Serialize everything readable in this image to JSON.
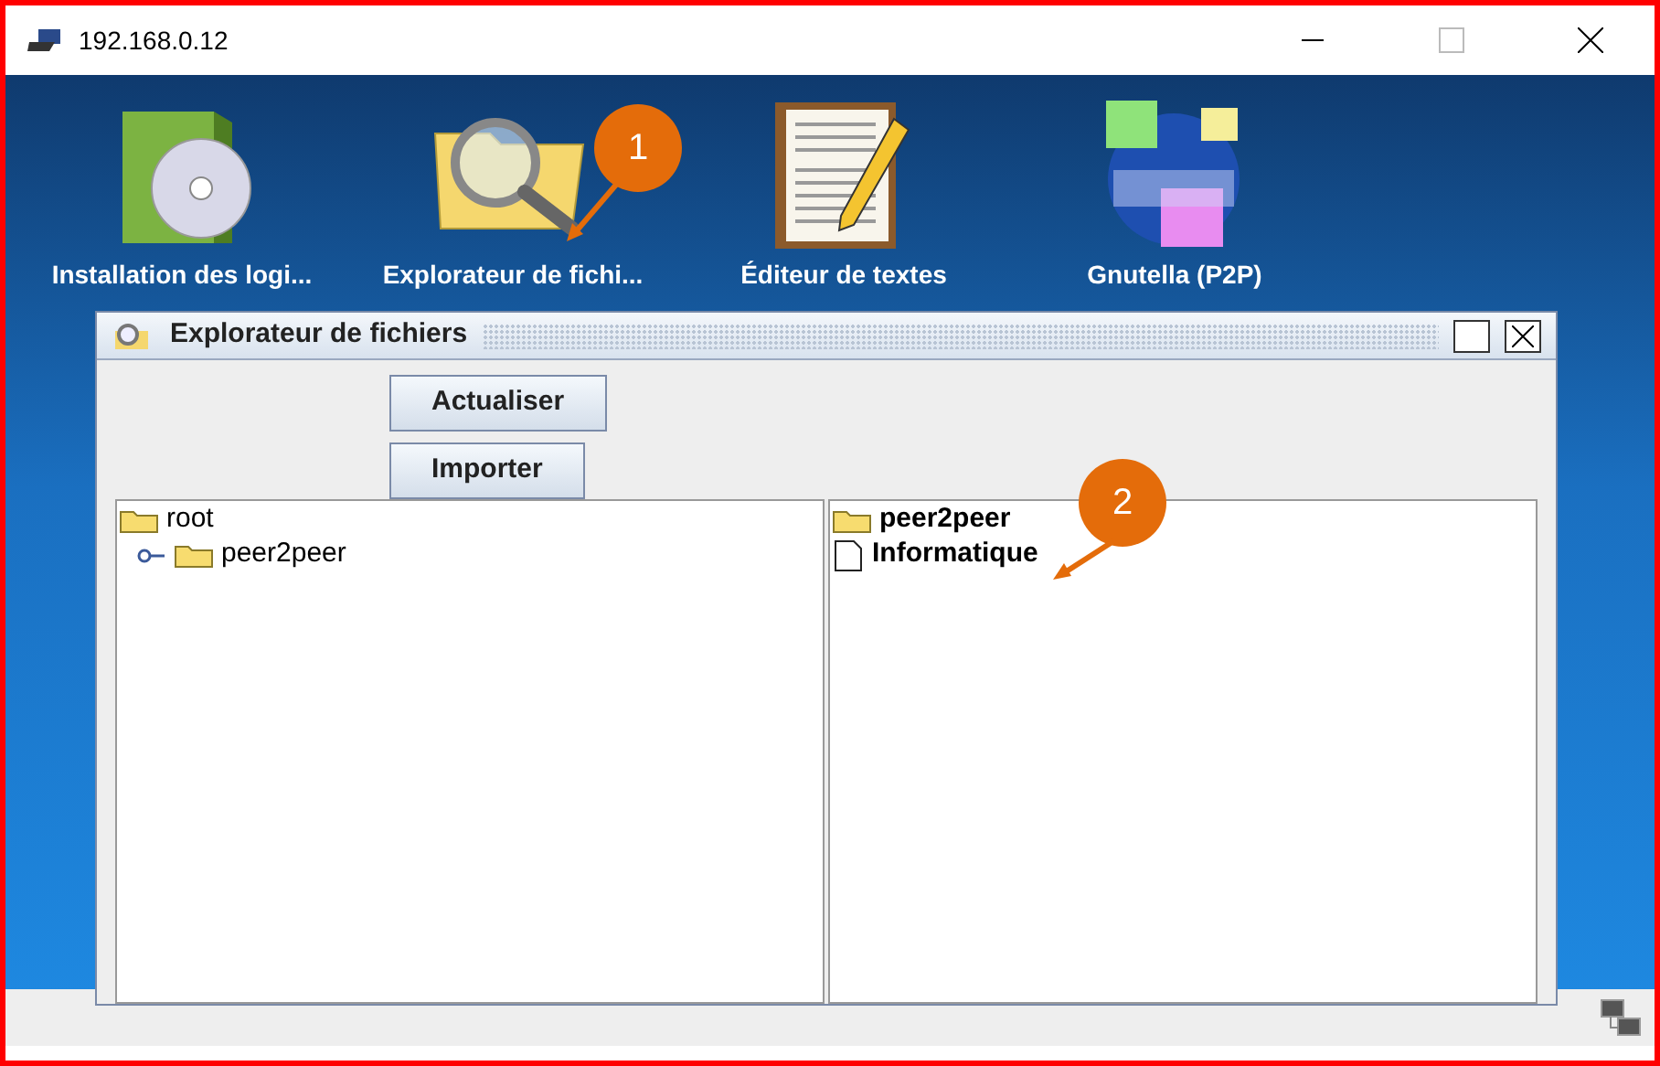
{
  "window": {
    "title": "192.168.0.12"
  },
  "desktop_icons": [
    {
      "label": "Installation des logi...",
      "kind": "software"
    },
    {
      "label": "Explorateur de fichi...",
      "kind": "explorer"
    },
    {
      "label": "Éditeur de textes",
      "kind": "editor"
    },
    {
      "label": "Gnutella (P2P)",
      "kind": "p2p"
    }
  ],
  "explorer": {
    "title": "Explorateur de fichiers",
    "buttons": [
      "Actualiser",
      "Importer"
    ],
    "tree": [
      {
        "label": "root",
        "children": [
          {
            "label": "peer2peer",
            "expanded": false
          }
        ]
      }
    ],
    "list": [
      {
        "label": "peer2peer",
        "kind": "folder"
      },
      {
        "label": "Informatique",
        "kind": "file"
      }
    ]
  },
  "annotations": [
    {
      "label": "1"
    },
    {
      "label": "2"
    }
  ]
}
